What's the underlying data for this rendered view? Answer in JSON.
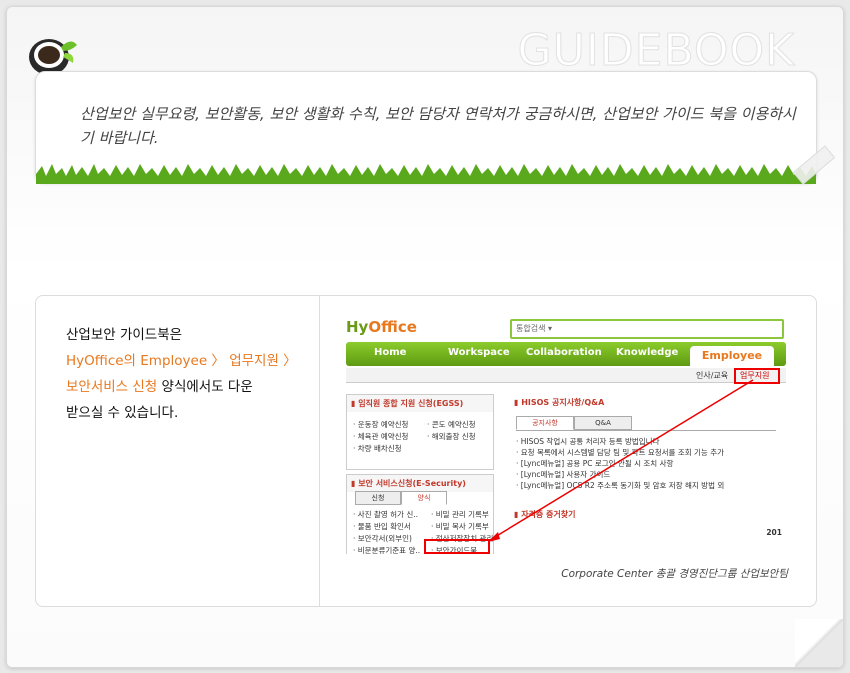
{
  "header": {
    "watermark": "GUIDEBOOK"
  },
  "banner": {
    "text": "산업보안 실무요령, 보안활동, 보안 생활화 수칙, 보안 담당자 연락처가 궁금하시면, 산업보안 가이드 북을 이용하시기 바랍니다."
  },
  "content": {
    "line1": "산업보안 가이드북은",
    "line2_link": "HyOffice의 Employee 〉 업무지원 〉",
    "line3_link": "보안서비스 신청",
    "line3_rest": " 양식에서도 다운",
    "line4": "받으실 수 있습니다.",
    "caption": "Corporate Center 총괄 경영진단그룹 산업보안팀"
  },
  "screenshot": {
    "logo_a": "Hy",
    "logo_b": "Office",
    "search_label": "통합검색 ▾",
    "nav": [
      "Home",
      "Workspace",
      "Collaboration",
      "Knowledge"
    ],
    "nav_active": "Employee",
    "subnav_a": "인사/교육",
    "subnav_b": "업무지원",
    "egss_title": "▮ 임직원 종합 지원 신청(EGSS)",
    "egss_items": [
      "· 운동장 예약신청",
      "· 콘도 예약신청",
      "· 체육관 예약신청",
      "· 해외출장 신청",
      "· 차량 배차신청"
    ],
    "sec_title": "▮ 보안 서비스신청(E-Security)",
    "sec_tabs": [
      "신청",
      "양식"
    ],
    "sec_items": [
      "· 사진 촬영 허가 신..",
      "· 비밀 관리 기록부",
      "· 물품 반입 확인서",
      "· 비밀 복사 기록부",
      "· 보안각서(외부인)",
      "· 전산저장장치 관리",
      "· 비문분류기준표 양..",
      "· 보안가이드북"
    ],
    "notice_title": "▮ HISOS 공지사항/Q&A",
    "notice_tabs": [
      "공지사항",
      "Q&A"
    ],
    "notice_items": [
      "· HISOS 작업시 공통 처리자 등록 방법입니다",
      "· 요청 목록에서 시스템별 담당 팀 및 파트 요청서를 조회 기능 추가",
      "· [Lync메뉴얼] 공용 PC 로그인 안될 시 조치 사항",
      "· [Lync메뉴얼] 사용자 가이드",
      "· [Lync메뉴얼] OCS R2 주소록 동기화 및 암호 저장 해지 방법 외"
    ],
    "cert_title": "▮ 자격증 증거찾기",
    "cert_year": "201"
  },
  "colors": {
    "accent_orange": "#e8781e",
    "green": "#6a9a18",
    "red": "#e00000"
  }
}
